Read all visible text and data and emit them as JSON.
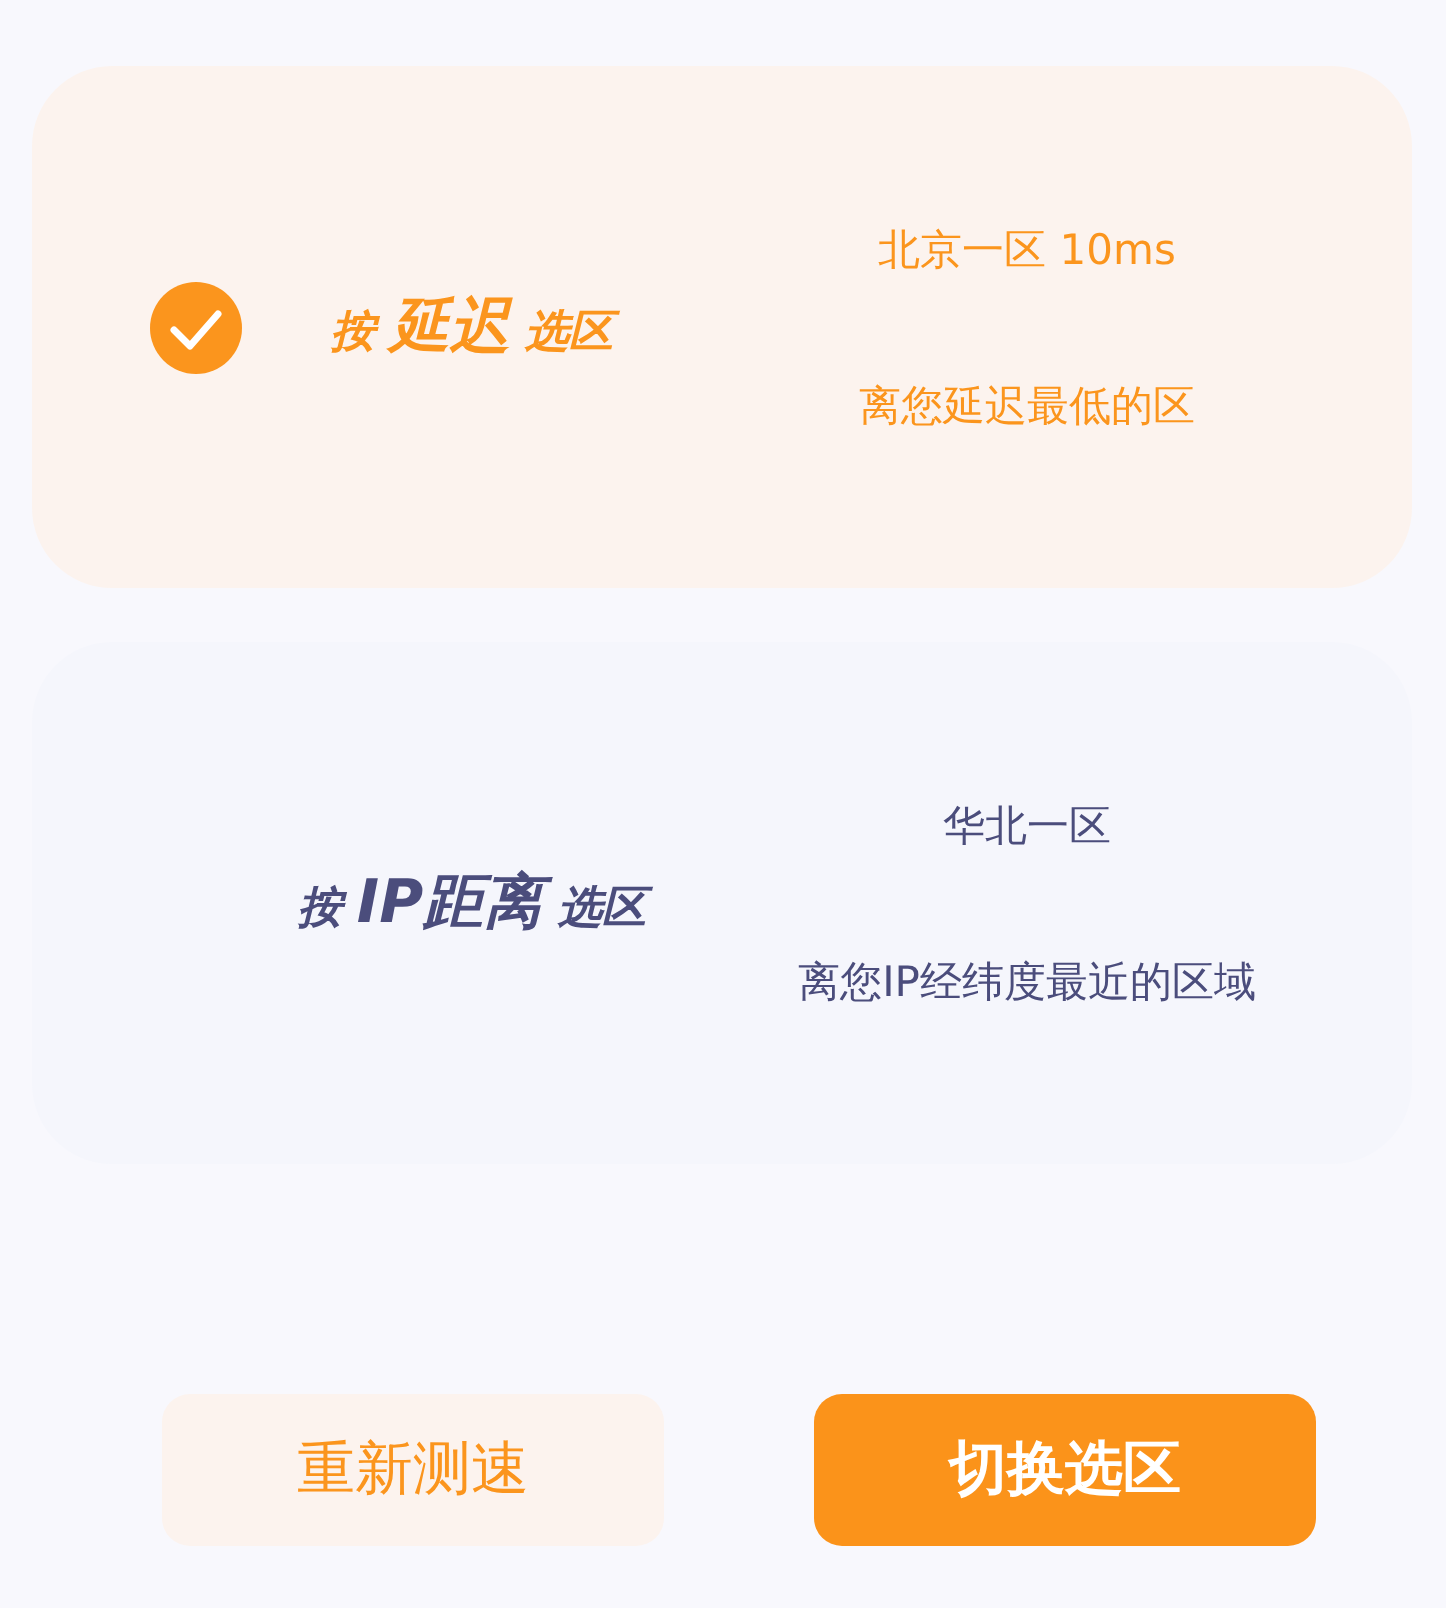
{
  "options": [
    {
      "title": "按 **延迟** 选区",
      "region": "北京一区 10ms",
      "description": "离您延迟最低的区",
      "selected": true
    },
    {
      "title": "按 **IP距离** 选区",
      "region": "华北一区",
      "description": "离您IP经纬度最近的区域",
      "selected": false
    }
  ],
  "buttons": [
    {
      "label": "重新测速",
      "kind": "secondary"
    },
    {
      "label": "切换选区",
      "kind": "primary"
    }
  ]
}
